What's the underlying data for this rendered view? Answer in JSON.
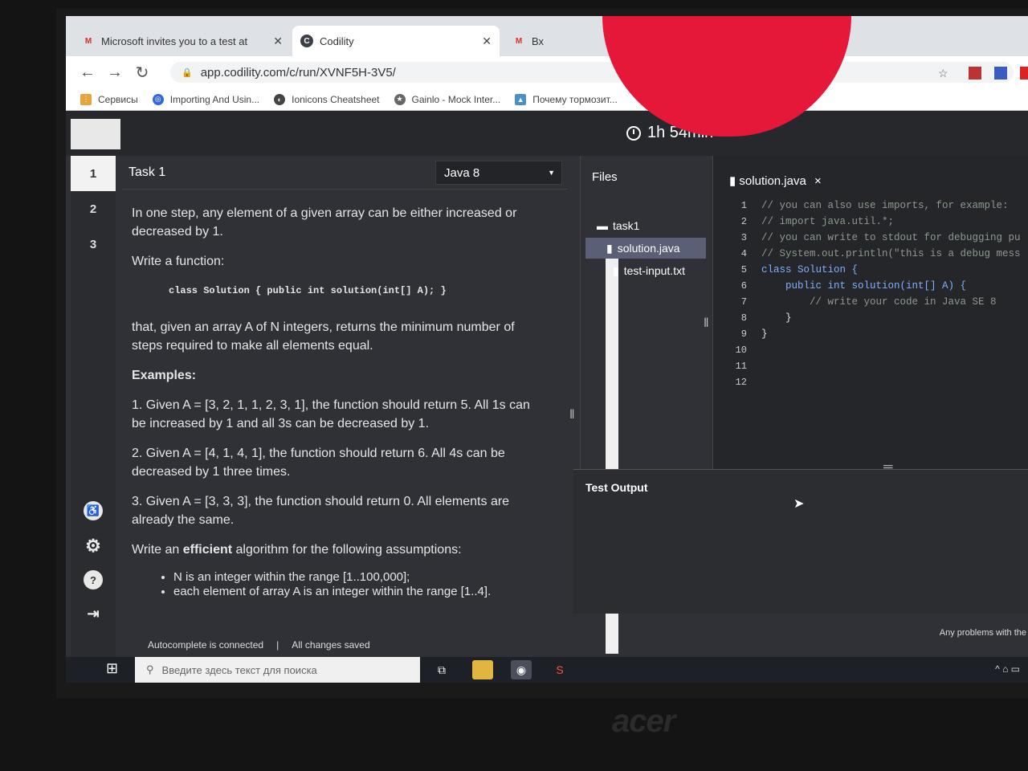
{
  "browser": {
    "tabs": [
      {
        "title": "Microsoft invites you to a test at",
        "favicon": "gmail-icon",
        "active": false
      },
      {
        "title": "Codility",
        "favicon": "codility-icon",
        "active": true
      },
      {
        "title": "Вх",
        "favicon": "gmail-icon",
        "active": false
      }
    ],
    "url": "app.codility.com/c/run/XVNF5H-3V5/",
    "bookmarks": [
      {
        "label": "Сервисы"
      },
      {
        "label": "Importing And Usin..."
      },
      {
        "label": "Ionicons Cheatsheet"
      },
      {
        "label": "Gainlo - Mock Inter..."
      },
      {
        "label": "Почему тормозит..."
      }
    ]
  },
  "app": {
    "timer": "1h 54min",
    "tasks": [
      "1",
      "2",
      "3"
    ],
    "task_title": "Task 1",
    "language": "Java 8",
    "task_text": {
      "intro": "In one step, any element of a given array can be either increased or decreased by 1.",
      "write": "Write a function:",
      "signature": "class Solution { public int solution(int[] A); }",
      "goal": "that, given an array A of N integers, returns the minimum number of steps required to make all elements equal.",
      "examples_heading": "Examples:",
      "examples": [
        "1. Given A = [3, 2, 1, 1, 2, 3, 1], the function should return 5. All 1s can be increased by 1 and all 3s can be decreased by 1.",
        "2. Given A = [4, 1, 4, 1], the function should return 6. All 4s can be decreased by 1 three times.",
        "3. Given A = [3, 3, 3], the function should return 0. All elements are already the same."
      ],
      "assumptions_pre": "Write an ",
      "assumptions_bold": "efficient",
      "assumptions_post": " algorithm for the following assumptions:",
      "assumptions": [
        "N is an integer within the range [1..100,000];",
        "each element of array A is an integer within the range [1..4]."
      ]
    },
    "files": {
      "heading": "Files",
      "folder": "task1",
      "items": [
        "solution.java",
        "test-input.txt"
      ]
    },
    "editor": {
      "tab": "solution.java",
      "lines": [
        "// you can also use imports, for example:",
        "// import java.util.*;",
        "",
        "// you can write to stdout for debugging pu",
        "// System.out.println(\"this is a debug mess",
        "",
        "class Solution {",
        "    public int solution(int[] A) {",
        "        // write your code in Java SE 8",
        "    }",
        "}",
        ""
      ]
    },
    "test_output_label": "Test Output",
    "status": {
      "autocomplete": "Autocomplete is connected",
      "saved": "All changes saved",
      "problems": "Any problems with the"
    }
  },
  "taskbar": {
    "search_placeholder": "Введите здесь текст для поиска"
  },
  "device": {
    "brand": "acer"
  },
  "colors": {
    "editor_bg": "#24262a",
    "app_bg": "#2f3136",
    "selection": "#5a5f75"
  }
}
